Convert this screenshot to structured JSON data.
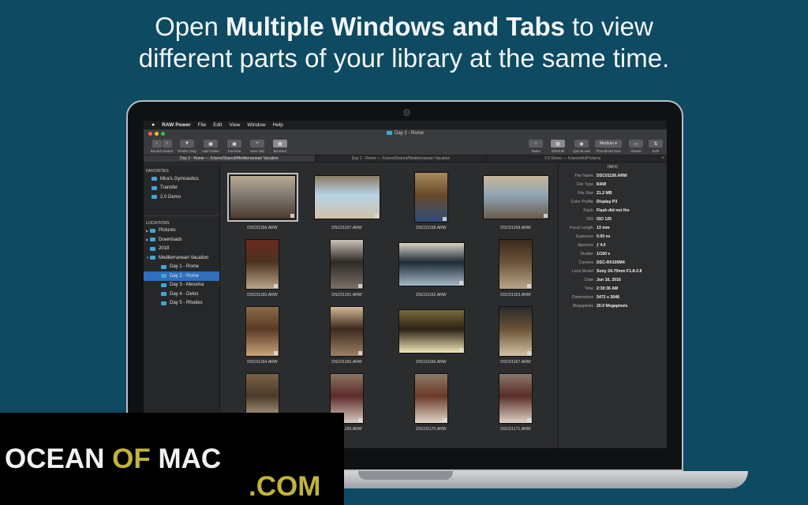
{
  "headline": {
    "line1_pre": "Open ",
    "line1_bold": "Multiple Windows and Tabs",
    "line1_post": " to view",
    "line2": "different parts of your library at the same time."
  },
  "menubar": {
    "apple": "",
    "items": [
      "RAW Power",
      "File",
      "Edit",
      "View",
      "Window",
      "Help"
    ]
  },
  "window": {
    "title": "Day 2 - Rome"
  },
  "toolbar": {
    "back_forward": "Back/Forward",
    "raws_only": "RAWs Only",
    "add_folder": "Add Folder",
    "favorite": "Favorite",
    "new_tab": "New Tab",
    "browser": "Browser",
    "tasks": "Tasks",
    "info_edit": "Info/Edit",
    "quicklook": "QuickLook",
    "thumbnail_size": "Thumbnail Size",
    "thumbnail_value": "Medium",
    "viewer": "Viewer",
    "edit": "Edit"
  },
  "tabs": [
    "Day 2 - Rome  —  /Users/Shared/Mediterranean Vacation",
    "Day 2 - Rome  —  /Users/Shared/Mediterranean Vacation",
    "2.0 Demo  —  /Users/nik/Pictures"
  ],
  "sidebar": {
    "favorites_label": "FAVORITES",
    "favorites": [
      "Mira's Gymnastics",
      "Transfer",
      "2.0 Demo"
    ],
    "locations_label": "LOCATIONS",
    "locations": [
      {
        "label": "Pictures",
        "level": 0,
        "arrow": "▶"
      },
      {
        "label": "Downloads",
        "level": 0,
        "arrow": "▶"
      },
      {
        "label": "2018",
        "level": 0,
        "arrow": ""
      },
      {
        "label": "Mediterranean Vacation",
        "level": 0,
        "arrow": "▼"
      },
      {
        "label": "Day 1 - Rome",
        "level": 1,
        "arrow": ""
      },
      {
        "label": "Day 2 - Rome",
        "level": 1,
        "arrow": "",
        "selected": true
      },
      {
        "label": "Day 3 - Messina",
        "level": 1,
        "arrow": ""
      },
      {
        "label": "Day 4 - Delos",
        "level": 1,
        "arrow": ""
      },
      {
        "label": "Day 5 - Rhodes",
        "level": 1,
        "arrow": ""
      }
    ]
  },
  "photos": [
    {
      "name": "DSC01156.ARW",
      "orient": "land",
      "selected": true,
      "colors": [
        "#7f7a72",
        "#4a3a2c",
        "#b9aa92"
      ]
    },
    {
      "name": "DSC01157.ARW",
      "orient": "land",
      "colors": [
        "#b7d3e8",
        "#cfc2a8",
        "#8a7a64"
      ]
    },
    {
      "name": "DSC01158.ARW",
      "orient": "port",
      "colors": [
        "#6a4a2a",
        "#2f4d7a",
        "#a88a5a"
      ]
    },
    {
      "name": "DSC01159.ARW",
      "orient": "land",
      "colors": [
        "#8fa4b4",
        "#6a5c4c",
        "#c9b79a"
      ]
    },
    {
      "name": "DSC01160.ARW",
      "orient": "port",
      "colors": [
        "#4c3220",
        "#b9a58a",
        "#6a2a1e"
      ]
    },
    {
      "name": "DSC01161.ARW",
      "orient": "port",
      "colors": [
        "#2e2a26",
        "#7a7066",
        "#c9c2b8"
      ]
    },
    {
      "name": "DSC01162.ARW",
      "orient": "land",
      "colors": [
        "#1e2a36",
        "#a6b8c6",
        "#d8d2c6"
      ]
    },
    {
      "name": "DSC01163.ARW",
      "orient": "port",
      "colors": [
        "#6a5238",
        "#b9a68a",
        "#3a2a1c"
      ]
    },
    {
      "name": "DSC01164.ARW",
      "orient": "port",
      "colors": [
        "#5a3a26",
        "#c9a47a",
        "#8a6a48"
      ]
    },
    {
      "name": "DSC01165.ARW",
      "orient": "port",
      "colors": [
        "#3c2a1e",
        "#9c8066",
        "#d2b894"
      ]
    },
    {
      "name": "DSC01166.ARW",
      "orient": "land",
      "colors": [
        "#2a2214",
        "#f2e6b8",
        "#7a6a3c"
      ]
    },
    {
      "name": "DSC01167.ARW",
      "orient": "port",
      "colors": [
        "#6a5236",
        "#d2c2a4",
        "#2a2a2a"
      ]
    },
    {
      "name": "DSC01168.ARW",
      "orient": "port",
      "colors": [
        "#4a3a2a",
        "#c8b69a",
        "#7a6248"
      ]
    },
    {
      "name": "DSC01169.ARW",
      "orient": "port",
      "colors": [
        "#5c2a2a",
        "#d6ccc0",
        "#8a7462"
      ]
    },
    {
      "name": "DSC01170.ARW",
      "orient": "port",
      "colors": [
        "#6a3a2a",
        "#e0d6c8",
        "#8c7a66"
      ]
    },
    {
      "name": "DSC01171.ARW",
      "orient": "port",
      "colors": [
        "#5a2c28",
        "#dcd2c4",
        "#8a786a"
      ]
    }
  ],
  "info": {
    "title": "INFO",
    "rows": [
      {
        "k": "File Name",
        "v": "DSC01156.ARW"
      },
      {
        "k": "File Type",
        "v": "RAW"
      },
      {
        "k": "File Size",
        "v": "21.2 MB"
      },
      {
        "k": "Color Profile",
        "v": "Display P3"
      },
      {
        "k": "Flash",
        "v": "Flash did not fire"
      },
      {
        "k": "ISO",
        "v": "ISO 125"
      },
      {
        "k": "Focal Length",
        "v": "13 mm"
      },
      {
        "k": "Exposure",
        "v": "0.00 ev"
      },
      {
        "k": "Aperture",
        "v": "ƒ 4.0"
      },
      {
        "k": "Shutter",
        "v": "1/160 s"
      },
      {
        "k": "Camera",
        "v": "DSC-RX100M4"
      },
      {
        "k": "Lens Model",
        "v": "Sony 24-70mm F1.8-2.8"
      },
      {
        "k": "Date",
        "v": "Jun 16, 2016"
      },
      {
        "k": "Time",
        "v": "2:30:36 AM"
      },
      {
        "k": "Dimensions",
        "v": "5472 x 3648"
      },
      {
        "k": "Megapixels",
        "v": "20.0 Megapixels"
      }
    ]
  },
  "watermark": {
    "ocean": "OCEAN",
    "of": "OF",
    "mac": "MAC",
    "com": ".COM"
  },
  "colors": {
    "background": "#0e4a62",
    "selection": "#2f6fc0",
    "folder": "#3fa7d6",
    "watermark_gold": "#c2b33b"
  }
}
